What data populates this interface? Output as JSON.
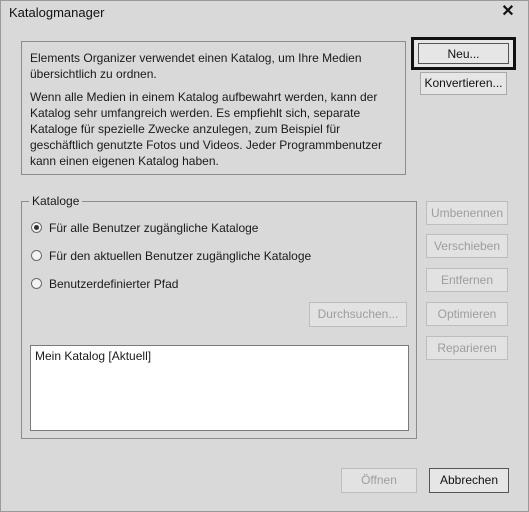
{
  "window": {
    "title": "Katalogmanager"
  },
  "info": {
    "paragraph1": "Elements Organizer verwendet einen Katalog, um Ihre Medien übersichtlich zu ordnen.",
    "paragraph2": "Wenn alle Medien in einem Katalog aufbewahrt werden, kann der Katalog sehr umfangreich werden. Es empfiehlt sich, separate Kataloge für spezielle Zwecke anzulegen, zum Beispiel für geschäftlich genutzte Fotos und Videos. Jeder Programmbenutzer kann einen eigenen Katalog haben."
  },
  "top_buttons": {
    "new": "Neu...",
    "convert": "Konvertieren..."
  },
  "catalogs": {
    "legend": "Kataloge",
    "options": [
      {
        "label": "Für alle Benutzer zugängliche Kataloge",
        "checked": true
      },
      {
        "label": "Für den aktuellen Benutzer zugängliche Kataloge",
        "checked": false
      },
      {
        "label": "Benutzerdefinierter Pfad",
        "checked": false
      }
    ],
    "browse": "Durchsuchen...",
    "items": [
      "Mein Katalog [Aktuell]"
    ]
  },
  "side_buttons": {
    "rename": "Umbenennen",
    "move": "Verschieben",
    "remove": "Entfernen",
    "optimize": "Optimieren",
    "repair": "Reparieren"
  },
  "footer": {
    "open": "Öffnen",
    "cancel": "Abbrechen"
  }
}
